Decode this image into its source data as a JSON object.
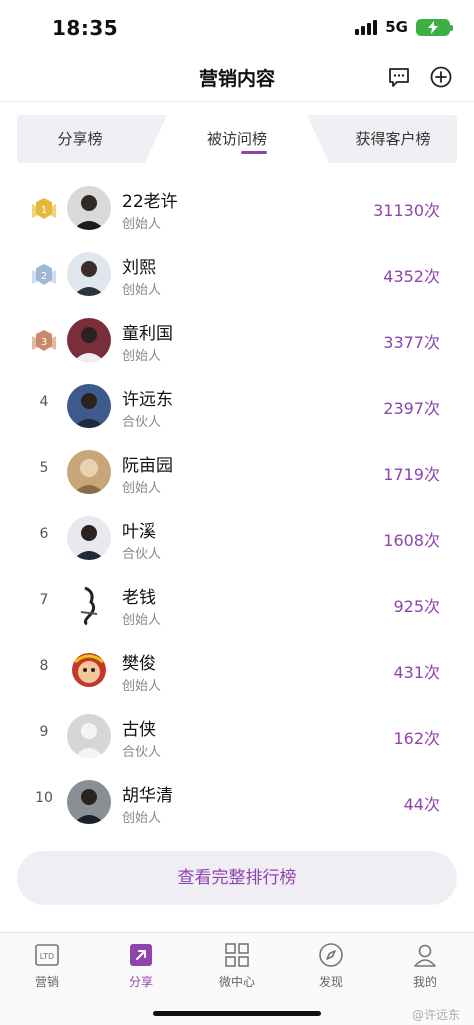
{
  "status": {
    "time": "18:35",
    "network": "5G"
  },
  "header": {
    "title": "营销内容"
  },
  "tabs": [
    {
      "label": "分享榜",
      "active": false
    },
    {
      "label": "被访问榜",
      "active": true
    },
    {
      "label": "获得客户榜",
      "active": false
    }
  ],
  "ranking": [
    {
      "rank": "1",
      "name": "22老许",
      "role": "创始人",
      "count": "31130次"
    },
    {
      "rank": "2",
      "name": "刘熙",
      "role": "创始人",
      "count": "4352次"
    },
    {
      "rank": "3",
      "name": "童利国",
      "role": "创始人",
      "count": "3377次"
    },
    {
      "rank": "4",
      "name": "许远东",
      "role": "合伙人",
      "count": "2397次"
    },
    {
      "rank": "5",
      "name": "阮亩园",
      "role": "创始人",
      "count": "1719次"
    },
    {
      "rank": "6",
      "name": "叶溪",
      "role": "合伙人",
      "count": "1608次"
    },
    {
      "rank": "7",
      "name": "老钱",
      "role": "创始人",
      "count": "925次"
    },
    {
      "rank": "8",
      "name": "樊俊",
      "role": "创始人",
      "count": "431次"
    },
    {
      "rank": "9",
      "name": "古侠",
      "role": "合伙人",
      "count": "162次"
    },
    {
      "rank": "10",
      "name": "胡华清",
      "role": "创始人",
      "count": "44次"
    }
  ],
  "full_rank_button": "查看完整排行榜",
  "tabbar": [
    {
      "label": "营销",
      "icon": "ltd-icon",
      "icon_text": "LTD",
      "active": false
    },
    {
      "label": "分享",
      "icon": "share-icon",
      "active": true
    },
    {
      "label": "微中心",
      "icon": "grid-icon",
      "active": false
    },
    {
      "label": "发现",
      "icon": "compass-icon",
      "active": false
    },
    {
      "label": "我的",
      "icon": "person-icon",
      "active": false
    }
  ],
  "watermark": "@许远东",
  "colors": {
    "accent": "#8e44ad",
    "battery": "#3cb043",
    "gold": "#e6b93a",
    "silver": "#9fb7d3",
    "bronze": "#c98a6b"
  }
}
